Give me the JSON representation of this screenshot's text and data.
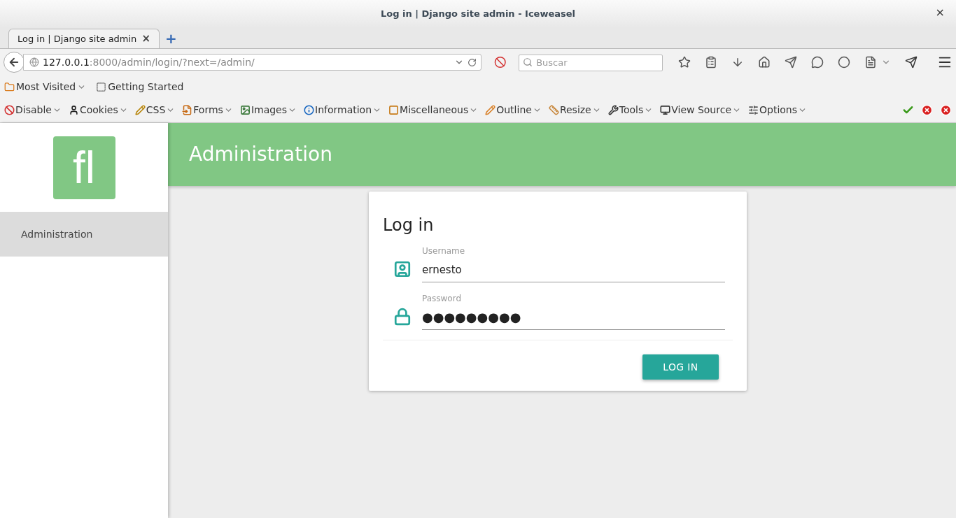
{
  "window": {
    "title": "Log in | Django site admin - Iceweasel",
    "close": "×"
  },
  "tabs": [
    {
      "label": "Log in | Django site admin",
      "selected": true,
      "close": "×"
    }
  ],
  "new_tab": "+",
  "address_bar": {
    "host": "127.0.0.1",
    "path": ":8000/admin/login/?next=/admin/"
  },
  "search": {
    "placeholder": "Buscar"
  },
  "bookmarks": [
    {
      "label": "Most Visited",
      "kind": "folder"
    },
    {
      "label": "Getting Started",
      "kind": "page"
    }
  ],
  "dev_toolbar": [
    {
      "label": "Disable",
      "kind": "disable"
    },
    {
      "label": "Cookies",
      "kind": "cookies"
    },
    {
      "label": "CSS",
      "kind": "css"
    },
    {
      "label": "Forms",
      "kind": "forms"
    },
    {
      "label": "Images",
      "kind": "images"
    },
    {
      "label": "Information",
      "kind": "info"
    },
    {
      "label": "Miscellaneous",
      "kind": "misc"
    },
    {
      "label": "Outline",
      "kind": "outline"
    },
    {
      "label": "Resize",
      "kind": "resize"
    },
    {
      "label": "Tools",
      "kind": "tools"
    },
    {
      "label": "View Source",
      "kind": "source"
    },
    {
      "label": "Options",
      "kind": "options"
    }
  ],
  "sidebar": {
    "logo": "fl",
    "items": [
      {
        "label": "Administration",
        "selected": true
      }
    ]
  },
  "header": {
    "title": "Administration"
  },
  "login": {
    "title": "Log in",
    "fields": [
      {
        "label": "Username",
        "value": "ernesto",
        "kind": "user"
      },
      {
        "label": "Password",
        "value": "●●●●●●●●●",
        "kind": "lock"
      }
    ],
    "button": "LOG IN"
  }
}
